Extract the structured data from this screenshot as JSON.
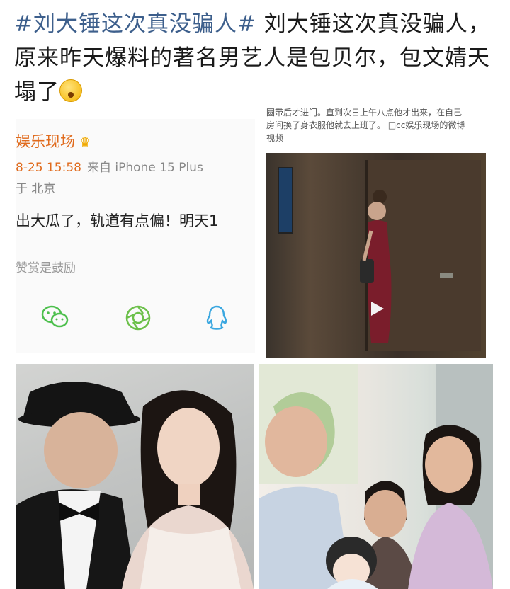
{
  "post": {
    "hashtag": "#刘大锤这次真没骗人#",
    "line1_rest": " 刘大锤这次真没骗人，",
    "line2": "原来昨天爆料的著名男艺人是包贝尔，包文婧天",
    "line3": "塌了"
  },
  "weibo_screenshot": {
    "author": "娱乐现场",
    "timestamp": "8-25 15:58",
    "source": "来自 iPhone 15 Plus",
    "location": "于 北京",
    "body": "出大瓜了，轨道有点偏！明天1",
    "reward_text": "赞赏是鼓励",
    "share_icons": [
      "wechat-icon",
      "moments-icon",
      "qq-icon"
    ]
  },
  "video_screenshot": {
    "caption_line1": "圆带后才进门。直到次日上午八点他才出来，在自己",
    "caption_line2": "房间换了身衣服他就去上班了。 □cc娱乐现场的微博",
    "caption_line3": "视频"
  },
  "colors": {
    "hashtag": "#3d5f8c",
    "author": "#e06b1d",
    "wechat": "#4cbf4c",
    "moments": "#6cc04a",
    "qq": "#3aa7e0"
  }
}
